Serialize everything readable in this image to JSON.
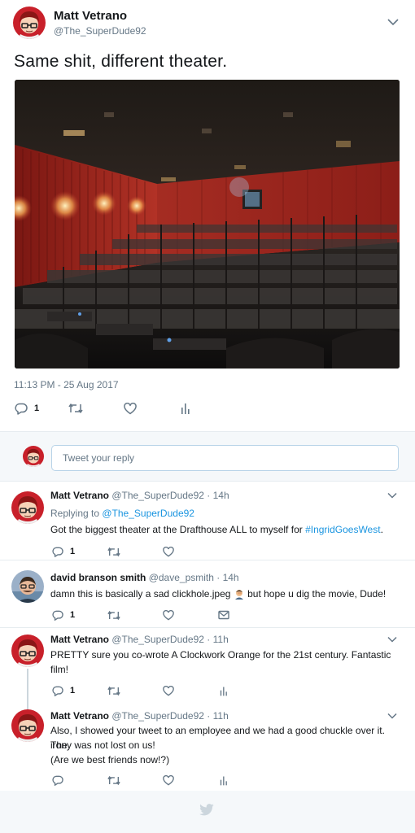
{
  "main_tweet": {
    "name": "Matt Vetrano",
    "handle": "@The_SuperDude92",
    "text": "Same shit, different theater.",
    "timestamp": "11:13 PM - 25 Aug 2017",
    "reply_count": "1",
    "photo_icon": "movie-theater-photo"
  },
  "reply_box": {
    "placeholder": "Tweet your reply"
  },
  "replies": [
    {
      "name": "Matt Vetrano",
      "handle": "@The_SuperDude92 · 14h",
      "replying_prefix": "Replying to ",
      "replying_to": "@The_SuperDude92",
      "text_before": "Got the biggest theater at the Drafthouse ALL to myself for ",
      "hashtag": "#IngridGoesWest",
      "text_after": ".",
      "reply_count": "1"
    },
    {
      "name": "david branson smith",
      "handle": "@dave_psmith · 14h",
      "text_before": "damn this is basically a sad clickhole.jpeg ",
      "emoji": "person-facepalming",
      "text_after": " but hope u dig the movie, Dude!",
      "reply_count": "1"
    },
    {
      "name": "Matt Vetrano",
      "handle": "@The_SuperDude92 · 11h",
      "text_line1": "PRETTY sure you co-wrote A Clockwork Orange for the 21st century. Fantastic",
      "text_line2": "film!",
      "reply_count": "1"
    },
    {
      "name": "Matt Vetrano",
      "handle": "@The_SuperDude92 · 11h",
      "text_line1": "Also, I showed your tweet to an employee and we had a good chuckle over it. The",
      "text_line2": "irony was not lost on us!",
      "text_line3": "(Are we best friends now!?)"
    }
  ],
  "colors": {
    "accent": "#1b95e0",
    "icon_gray": "#657786",
    "thread_line": "#ccd6dd"
  }
}
